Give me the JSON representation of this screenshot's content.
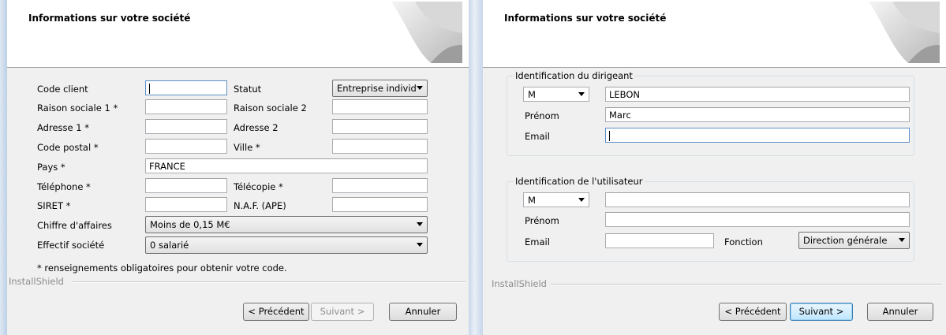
{
  "left_dialog": {
    "title": "Informations sur votre société",
    "fields": {
      "code_client": {
        "label": "Code client",
        "value": ""
      },
      "statut": {
        "label": "Statut",
        "value": "Entreprise individ"
      },
      "raison_sociale_1": {
        "label": "Raison sociale 1 *",
        "value": ""
      },
      "raison_sociale_2": {
        "label": "Raison sociale 2",
        "value": ""
      },
      "adresse_1": {
        "label": "Adresse 1 *",
        "value": ""
      },
      "adresse_2": {
        "label": "Adresse 2",
        "value": ""
      },
      "code_postal": {
        "label": "Code postal *",
        "value": ""
      },
      "ville": {
        "label": "Ville *",
        "value": ""
      },
      "pays": {
        "label": "Pays *",
        "value": "FRANCE"
      },
      "telephone": {
        "label": "Téléphone *",
        "value": ""
      },
      "telecopie": {
        "label": "Télécopie *",
        "value": ""
      },
      "siret": {
        "label": "SIRET *",
        "value": ""
      },
      "naf": {
        "label": "N.A.F. (APE)",
        "value": ""
      },
      "chiffre_affaires": {
        "label": "Chiffre d'affaires",
        "value": "Moins de 0,15 M€"
      },
      "effectif": {
        "label": "Effectif société",
        "value": "0 salarié"
      }
    },
    "note": "* renseignements obligatoires pour obtenir votre code.",
    "brand": "InstallShield",
    "buttons": {
      "back": "< Précédent",
      "next": "Suivant >",
      "cancel": "Annuler"
    }
  },
  "right_dialog": {
    "title": "Informations sur votre société",
    "dirigeant": {
      "group_title": "Identification du dirigeant",
      "civilite": "M",
      "nom": "LEBON",
      "prenom_label": "Prénom",
      "prenom": "Marc",
      "email_label": "Email",
      "email": ""
    },
    "utilisateur": {
      "group_title": "Identification de l'utilisateur",
      "civilite": "M",
      "nom": "",
      "prenom_label": "Prénom",
      "prenom": "",
      "email_label": "Email",
      "email": "",
      "fonction_label": "Fonction",
      "fonction": "Direction générale"
    },
    "brand": "InstallShield",
    "buttons": {
      "back": "< Précédent",
      "next": "Suivant >",
      "cancel": "Annuler"
    }
  }
}
